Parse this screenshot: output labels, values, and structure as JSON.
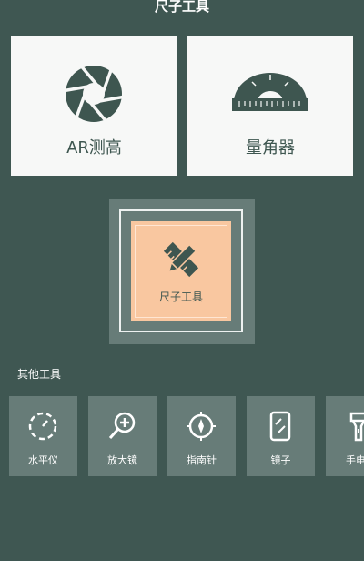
{
  "header": {
    "title": "尺子工具"
  },
  "cards": {
    "ar": {
      "label": "AR测高",
      "icon": "camera-aperture-icon"
    },
    "protractor": {
      "label": "量角器",
      "icon": "protractor-icon"
    }
  },
  "center": {
    "label": "尺子工具",
    "icon": "ruler-pencil-icon"
  },
  "other_tools": {
    "title": "其他工具",
    "items": [
      {
        "label": "水平仪",
        "icon": "level-icon"
      },
      {
        "label": "放大镜",
        "icon": "magnifier-icon"
      },
      {
        "label": "指南针",
        "icon": "compass-icon"
      },
      {
        "label": "镜子",
        "icon": "mirror-icon"
      },
      {
        "label": "手电",
        "icon": "flashlight-icon"
      }
    ]
  },
  "colors": {
    "background": "#3f5752",
    "card": "#f7f8f7",
    "tile": "#677c78",
    "accent_peach": "#f9c7a0",
    "icon_dark": "#3e5650"
  }
}
